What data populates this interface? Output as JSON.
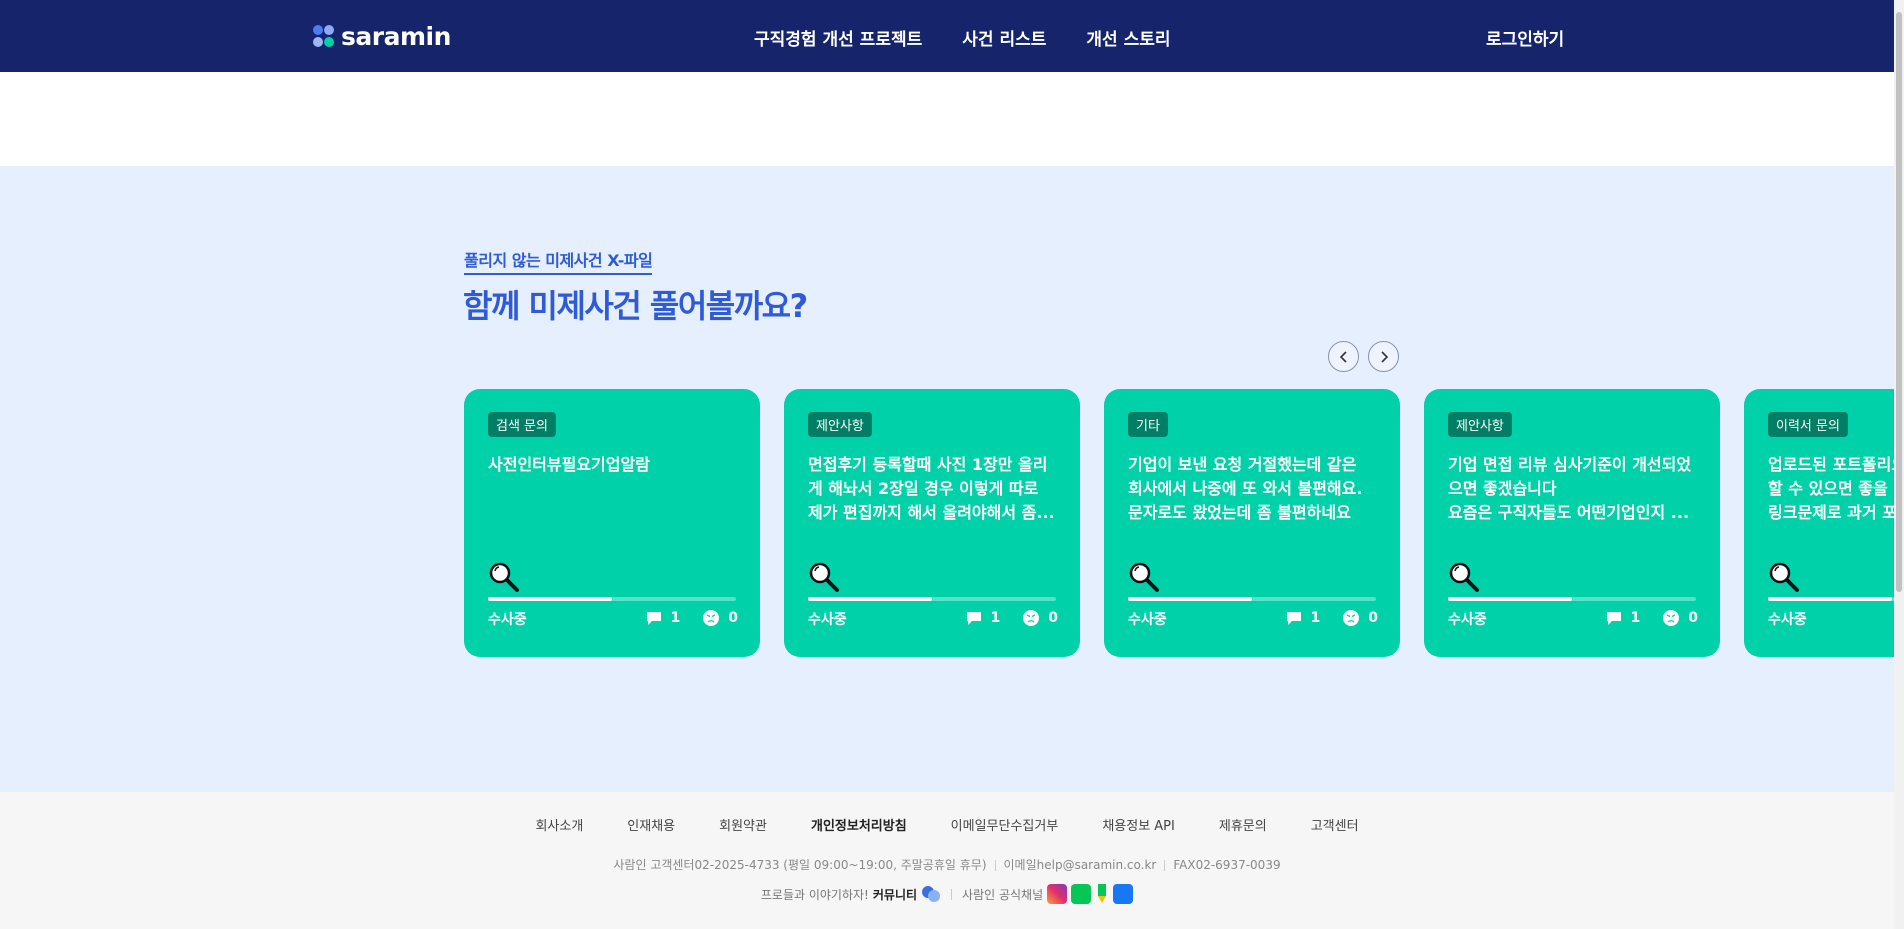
{
  "header": {
    "logo_text": "saramin",
    "nav": [
      "구직경험 개선 프로젝트",
      "사건 리스트",
      "개선 스토리"
    ],
    "login": "로그인하기"
  },
  "section": {
    "eyebrow": "풀리지 않는 미제사건 X-파일",
    "headline": "함께 미제사건 풀어볼까요?"
  },
  "cards": [
    {
      "tag": "검색 문의",
      "text": "사전인터뷰필요기업알람",
      "status": "수사중",
      "comments": "1",
      "reactions": "0",
      "progress": 0.5
    },
    {
      "tag": "제안사항",
      "text": "면접후기 등록할때 사진 1장만 올리\n게 해놔서 2장일 경우 이렇게 따로\n제가 편집까지 해서 올려야해서 좀...",
      "status": "수사중",
      "comments": "1",
      "reactions": "0",
      "progress": 0.5
    },
    {
      "tag": "기타",
      "text": "기업이 보낸 요청 거절했는데 같은\n회사에서 나중에 또 와서 불편해요.\n문자로도 왔었는데 좀 불편하네요",
      "status": "수사중",
      "comments": "1",
      "reactions": "0",
      "progress": 0.5
    },
    {
      "tag": "제안사항",
      "text": "기업 면접 리뷰 심사기준이 개선되었\n으면 좋겠습니다\n요즘은 구직자들도 어떤기업인지 ...",
      "status": "수사중",
      "comments": "1",
      "reactions": "0",
      "progress": 0.5
    },
    {
      "tag": "이력서 문의",
      "text": "업로드된 포트폴리오\n할 수 있으면 좋을 것\n링크문제로 과거 포트",
      "status": "수사중",
      "comments": "",
      "reactions": "",
      "progress": 0.5
    }
  ],
  "footer": {
    "links": [
      "회사소개",
      "인재채용",
      "회원약관",
      "개인정보처리방침",
      "이메일무단수집거부",
      "채용정보 API",
      "제휴문의",
      "고객센터"
    ],
    "bold_link_index": 3,
    "phone": "사람인 고객센터02-2025-4733 (평일 09:00~19:00, 주말공휴일 휴무)",
    "email": "이메일help@saramin.co.kr",
    "fax": "FAX02-6937-0039",
    "community_prefix": "프로들과 이야기하자!",
    "community": "커뮤니티",
    "official_channel": "사람인 공식채널"
  },
  "colors": {
    "header_bg": "#15246b",
    "section_bg": "#e6effd",
    "card_bg": "#00d1a9",
    "accent_blue": "#2f5bd6"
  }
}
